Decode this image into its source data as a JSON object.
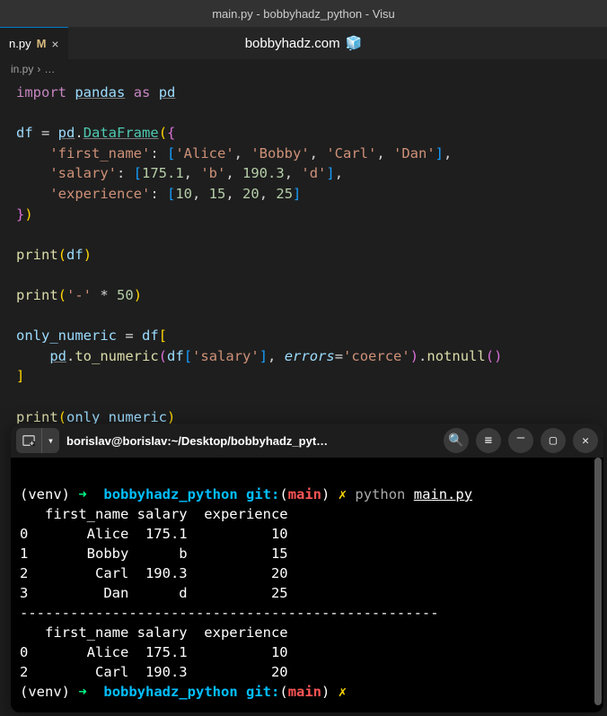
{
  "title_bar": "main.py - bobbyhadz_python - Visu",
  "tab": {
    "filename": "n.py",
    "modified": "M",
    "close": "×"
  },
  "watermark": "bobbyhadz.com",
  "breadcrumb": {
    "file": "in.py",
    "sep": "›",
    "more": "…"
  },
  "code": {
    "import": "import",
    "pandas": "pandas",
    "as": "as",
    "pd": "pd",
    "df": "df",
    "eq": " = ",
    "dot": ".",
    "DataFrame": "DataFrame",
    "first_name": "'first_name'",
    "colon": ": ",
    "alice": "'Alice'",
    "bobby": "'Bobby'",
    "carl": "'Carl'",
    "dan": "'Dan'",
    "salary": "'salary'",
    "n175": "175.1",
    "sb": "'b'",
    "n190": "190.3",
    "sd": "'d'",
    "experience": "'experience'",
    "n10": "10",
    "n15": "15",
    "n20": "20",
    "n25": "25",
    "print": "print",
    "dash": "'-'",
    "star": " * ",
    "n50": "50",
    "only_numeric": "only_numeric",
    "to_numeric": "to_numeric",
    "errors": "errors",
    "coerce": "'coerce'",
    "notnull": "notnull",
    "comma": ", "
  },
  "terminal": {
    "title": "borislav@borislav:~/Desktop/bobbyhadz_pyt…",
    "venv": "(venv)",
    "arrow": "➜",
    "dir": "bobbyhadz_python",
    "git": "git:",
    "branch": "main",
    "x": "✗",
    "cmd_python": "python",
    "cmd_file": "main.py",
    "row_hdr": "   first_name salary  experience",
    "row0": "0       Alice  175.1          10",
    "row1": "1       Bobby      b          15",
    "row2": "2        Carl  190.3          20",
    "row3": "3         Dan      d          25",
    "sep": "--------------------------------------------------",
    "row0b": "0       Alice  175.1          10",
    "row2b": "2        Carl  190.3          20"
  }
}
